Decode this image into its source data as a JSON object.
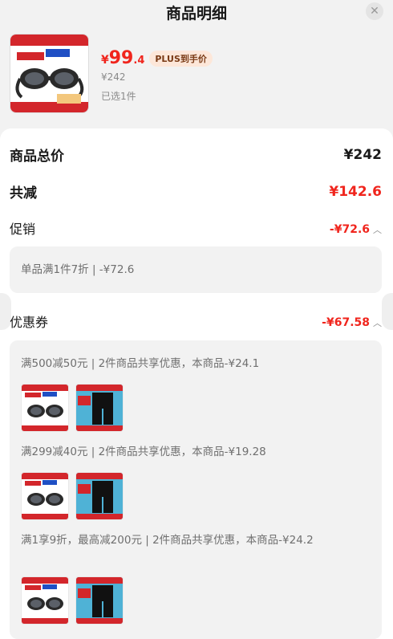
{
  "header": {
    "title": "商品明细"
  },
  "product": {
    "price_currency": "¥",
    "price_integer": "99",
    "price_decimal": ".4",
    "plus_badge": "PLUS到手价",
    "original_price": "¥242",
    "selected_count": "已选1件"
  },
  "summary": {
    "total_label": "商品总价",
    "total_value": "¥242",
    "discount_label": "共减",
    "discount_value": "¥142.6",
    "promo_label": "促销",
    "promo_value": "-¥72.6",
    "promo_detail": "单品满1件7折 | -¥72.6",
    "coupon_label": "优惠券",
    "coupon_value": "-¥67.58"
  },
  "coupons": [
    {
      "text": "满500减50元 | 2件商品共享优惠，本商品-¥24.1"
    },
    {
      "text": "满299减40元 | 2件商品共享优惠，本商品-¥19.28"
    },
    {
      "text": "满1享9折，最高减200元 | 2件商品共享优惠，本商品-¥24.2"
    }
  ],
  "colors": {
    "accent_red": "#f0251d",
    "badge_bg": "#fde7d9"
  }
}
